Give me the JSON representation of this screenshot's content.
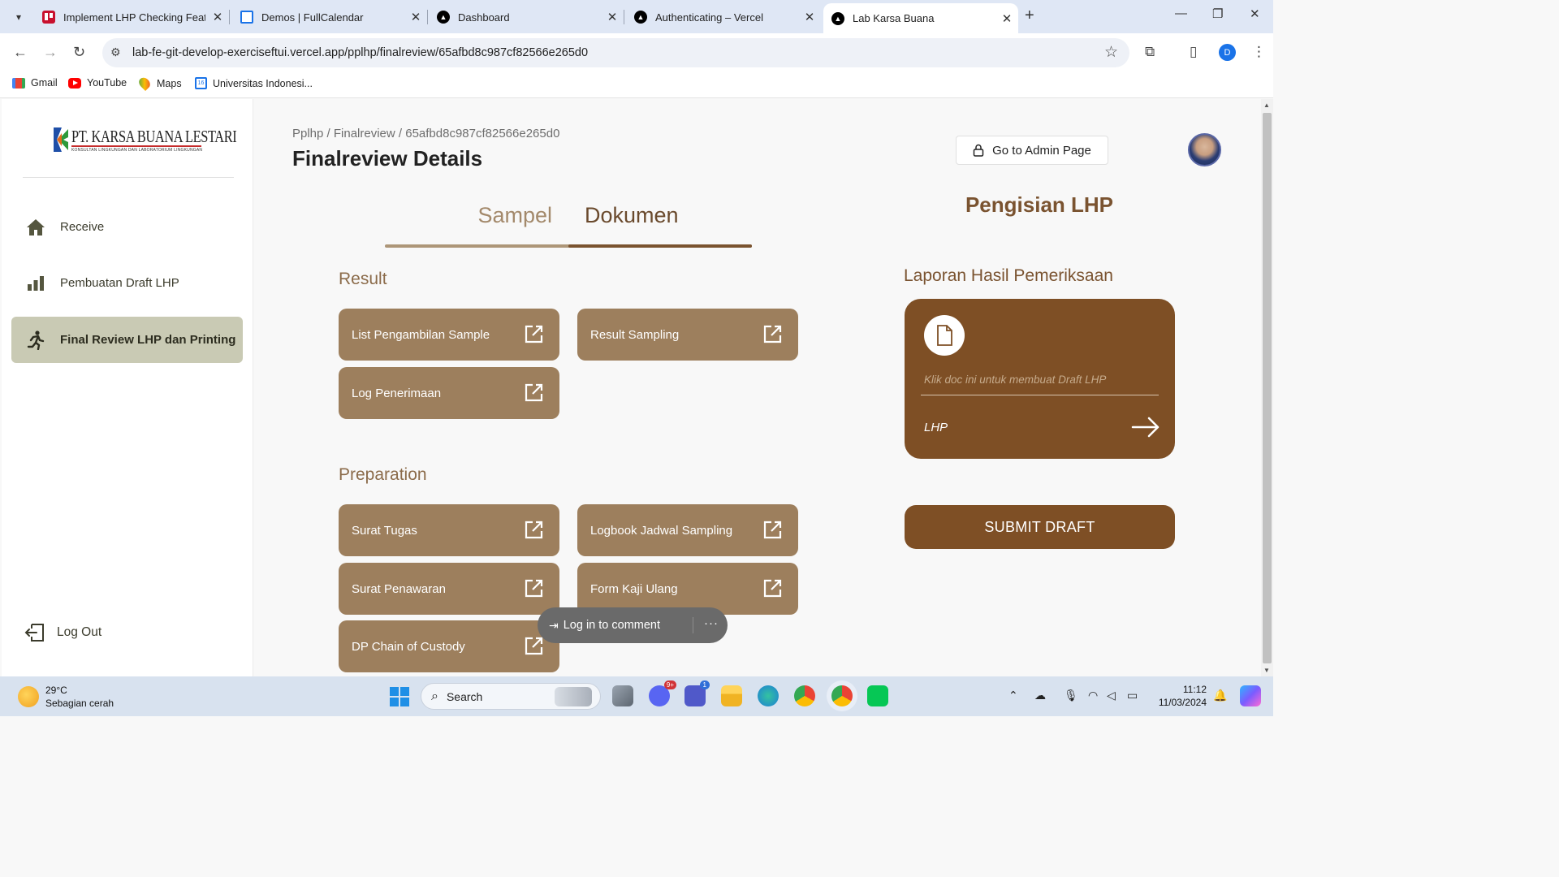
{
  "browser": {
    "tabs": [
      {
        "title": "Implement LHP Checking Featu",
        "favicon": "trello-icon",
        "color": "#c8102e"
      },
      {
        "title": "Demos | FullCalendar",
        "favicon": "calendar-icon",
        "color": "#1a73e8"
      },
      {
        "title": "Dashboard",
        "favicon": "vercel-icon",
        "color": "#000000"
      },
      {
        "title": "Authenticating – Vercel",
        "favicon": "vercel-icon",
        "color": "#000000"
      },
      {
        "title": "Lab Karsa Buana",
        "favicon": "vercel-icon",
        "color": "#000000",
        "active": true
      }
    ],
    "url": "lab-fe-git-develop-exerciseftui.vercel.app/pplhp/finalreview/65afbd8c987cf82566e265d0",
    "profile_initial": "D",
    "bookmarks": [
      {
        "label": "Gmail",
        "icon": "gmail-icon"
      },
      {
        "label": "YouTube",
        "icon": "youtube-icon"
      },
      {
        "label": "Maps",
        "icon": "maps-icon"
      },
      {
        "label": "Universitas Indonesi...",
        "icon": "calendar-16-icon"
      }
    ]
  },
  "sidebar": {
    "logo": {
      "name": "PT. KARSA BUANA LESTARI",
      "tagline": "KONSULTAN LINGKUNGAN DAN LABORATORIUM LINGKUNGAN"
    },
    "items": [
      {
        "label": "Receive",
        "icon": "home-icon",
        "active": false
      },
      {
        "label": "Pembuatan Draft LHP",
        "icon": "bar-chart-icon",
        "active": false
      },
      {
        "label": "Final Review LHP dan Printing",
        "icon": "running-person-icon",
        "active": true
      }
    ],
    "logout_label": "Log Out"
  },
  "header": {
    "breadcrumb": "Pplhp / Finalreview / 65afbd8c987cf82566e265d0",
    "title": "Finalreview Details",
    "admin_button": "Go to Admin Page"
  },
  "tabs": {
    "items": [
      "Sampel",
      "Dokumen"
    ],
    "active": "Dokumen"
  },
  "sections": {
    "result": {
      "title": "Result",
      "buttons": [
        "List Pengambilan Sample",
        "Result Sampling",
        "Log Penerimaan"
      ]
    },
    "preparation": {
      "title": "Preparation",
      "buttons": [
        "Surat Tugas",
        "Logbook Jadwal Sampling",
        "Surat Penawaran",
        "Form Kaji Ulang",
        "DP Chain of Custody"
      ]
    }
  },
  "lhp": {
    "heading": "Pengisian LHP",
    "subheading": "Laporan Hasil Pemeriksaan",
    "card_hint": "Klik doc ini untuk membuat Draft LHP",
    "card_label": "LHP",
    "submit_label": "SUBMIT DRAFT"
  },
  "comment_pill": {
    "label": "Log in to comment",
    "more": "···"
  },
  "taskbar": {
    "weather_temp": "29°C",
    "weather_desc": "Sebagian cerah",
    "search_label": "Search",
    "time": "11:12",
    "date": "11/03/2024",
    "discord_badge": "9+",
    "teams_badge": "1"
  },
  "colors": {
    "accent_brown": "#7e4f25",
    "button_tan": "#9d7f5d",
    "sidebar_active": "#c9cab4"
  }
}
